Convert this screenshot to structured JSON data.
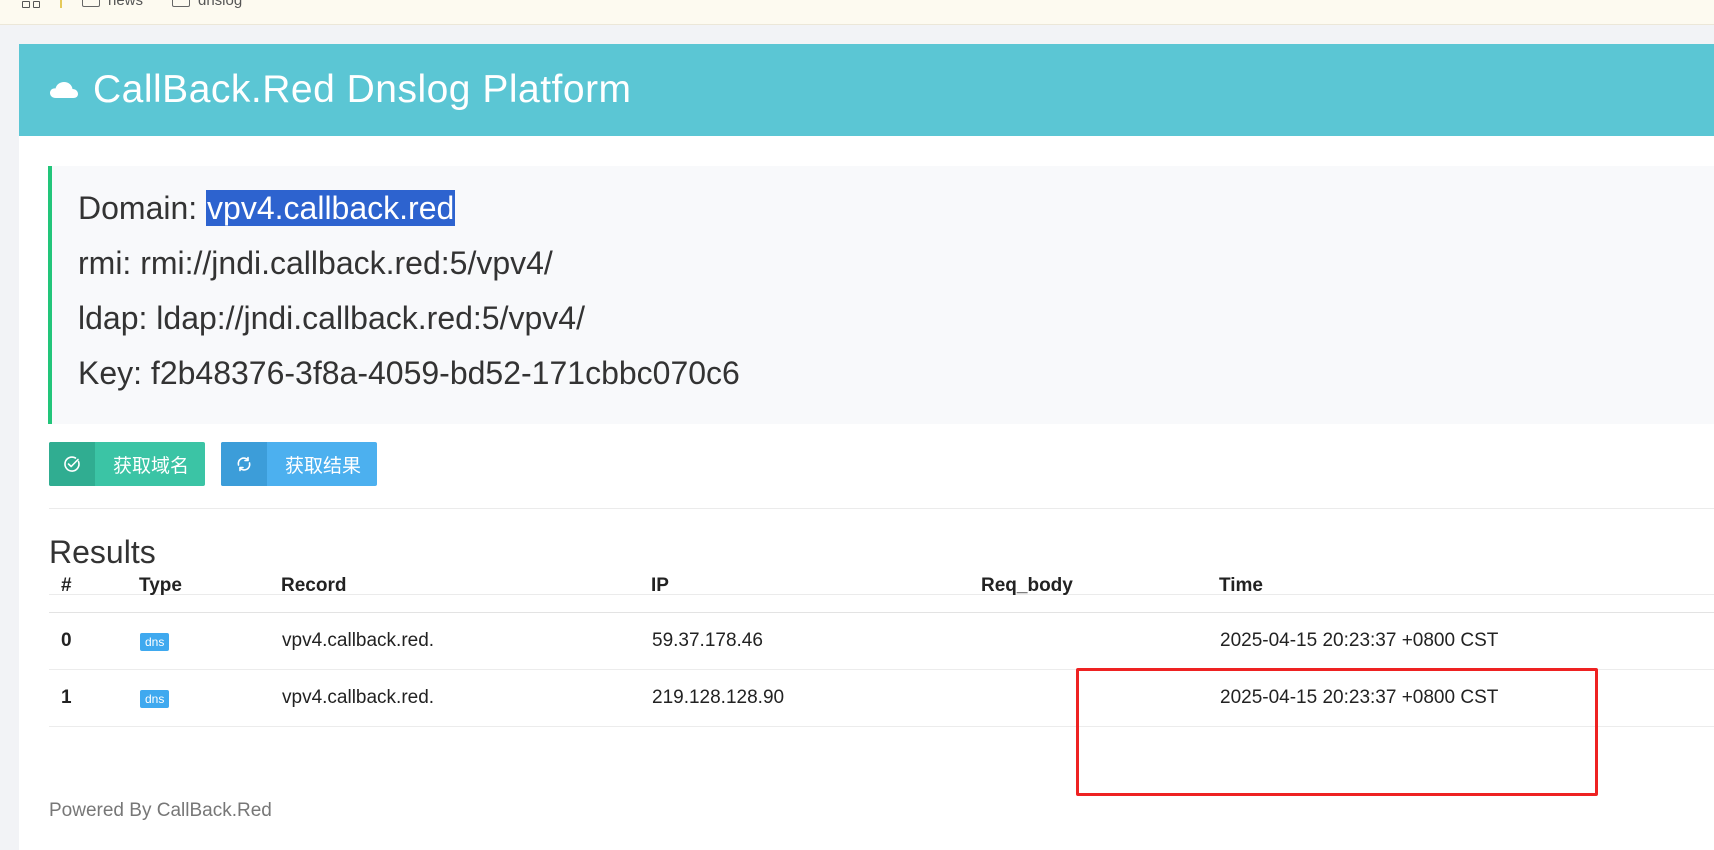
{
  "bookmarks": {
    "items": [
      {
        "label": "news"
      },
      {
        "label": "dnslog"
      }
    ]
  },
  "header": {
    "title": "CallBack.Red Dnslog Platform",
    "icon": "cloud-icon"
  },
  "info": {
    "domain_label": "Domain: ",
    "domain_value": "vpv4.callback.red",
    "rmi_label": "rmi: ",
    "rmi_value": "rmi://jndi.callback.red:5/vpv4/",
    "ldap_label": "ldap: ",
    "ldap_value": "ldap://jndi.callback.red:5/vpv4/",
    "key_label": "Key: ",
    "key_value": "f2b48376-3f8a-4059-bd52-171cbbc070c6"
  },
  "buttons": {
    "get_domain": "获取域名",
    "get_results": "获取结果"
  },
  "results": {
    "title": "Results",
    "columns": [
      "#",
      "Type",
      "Record",
      "IP",
      "Req_body",
      "Time"
    ],
    "rows": [
      {
        "num": "0",
        "type": "dns",
        "record": "vpv4.callback.red.",
        "ip": "59.37.178.46",
        "req_body": "",
        "time": "2025-04-15 20:23:37 +0800 CST"
      },
      {
        "num": "1",
        "type": "dns",
        "record": "vpv4.callback.red.",
        "ip": "219.128.128.90",
        "req_body": "",
        "time": "2025-04-15 20:23:37 +0800 CST"
      }
    ]
  },
  "footer": {
    "text": "Powered By CallBack.Red"
  },
  "colors": {
    "header_bg": "#5bc6d4",
    "accent_green": "#22c57a",
    "button_green": "#3bc4a5",
    "button_blue": "#4cb0ef",
    "badge_blue": "#3fa9ef",
    "annotation_red": "#ee2222",
    "selection_blue": "#2d63cf"
  }
}
